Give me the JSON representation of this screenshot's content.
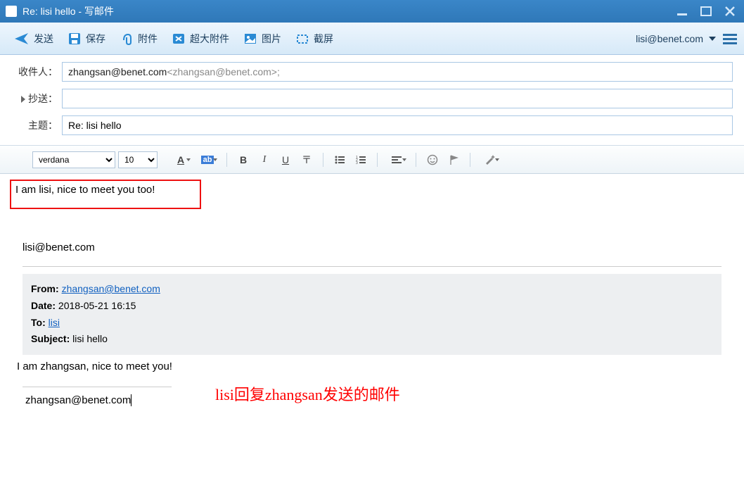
{
  "window": {
    "title": "Re: lisi hello - 写邮件"
  },
  "toolbar": {
    "send": "发送",
    "save": "保存",
    "attach": "附件",
    "large_attach": "超大附件",
    "image": "图片",
    "screenshot": "截屏",
    "account": "lisi@benet.com"
  },
  "headers": {
    "to_label": "收件人：",
    "to_value_name": "zhangsan@benet.com",
    "to_value_email": "<zhangsan@benet.com>;",
    "cc_label": "抄送：",
    "cc_value": "",
    "subject_label": "主题：",
    "subject_value": "Re: lisi hello"
  },
  "format": {
    "font": "verdana",
    "size": "10"
  },
  "body": {
    "reply_text": "I am lisi, nice to meet you too!",
    "annotation": "lisi回复zhangsan发送的邮件",
    "signature1": "lisi@benet.com",
    "quote": {
      "from_label": "From:",
      "from_value": "zhangsan@benet.com",
      "date_label": "Date:",
      "date_value": "2018-05-21 16:15",
      "to_label": "To:",
      "to_value": "lisi",
      "subject_label": "Subject:",
      "subject_value": "lisi hello"
    },
    "original_body": "I am zhangsan, nice to meet you!",
    "signature2": "zhangsan@benet.com"
  }
}
